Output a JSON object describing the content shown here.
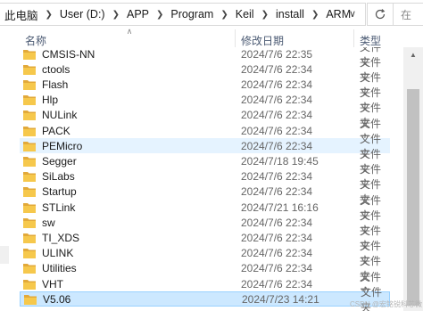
{
  "address": {
    "crumbs": [
      "此电脑",
      "User (D:)",
      "APP",
      "Program",
      "Keil",
      "install",
      "ARM"
    ],
    "search_placeholder": "在"
  },
  "columns": {
    "name": "名称",
    "date": "修改日期",
    "type": "类型"
  },
  "rows": [
    {
      "name": "CMSIS-NN",
      "date": "2024/7/6 22:35",
      "type": "文件夹"
    },
    {
      "name": "ctools",
      "date": "2024/7/6 22:34",
      "type": "文件夹"
    },
    {
      "name": "Flash",
      "date": "2024/7/6 22:34",
      "type": "文件夹"
    },
    {
      "name": "Hlp",
      "date": "2024/7/6 22:34",
      "type": "文件夹"
    },
    {
      "name": "NULink",
      "date": "2024/7/6 22:34",
      "type": "文件夹"
    },
    {
      "name": "PACK",
      "date": "2024/7/6 22:34",
      "type": "文件夹"
    },
    {
      "name": "PEMicro",
      "date": "2024/7/6 22:34",
      "type": "文件夹"
    },
    {
      "name": "Segger",
      "date": "2024/7/18 19:45",
      "type": "文件夹"
    },
    {
      "name": "SiLabs",
      "date": "2024/7/6 22:34",
      "type": "文件夹"
    },
    {
      "name": "Startup",
      "date": "2024/7/6 22:34",
      "type": "文件夹"
    },
    {
      "name": "STLink",
      "date": "2024/7/21 16:16",
      "type": "文件夹"
    },
    {
      "name": "sw",
      "date": "2024/7/6 22:34",
      "type": "文件夹"
    },
    {
      "name": "TI_XDS",
      "date": "2024/7/6 22:34",
      "type": "文件夹"
    },
    {
      "name": "ULINK",
      "date": "2024/7/6 22:34",
      "type": "文件夹"
    },
    {
      "name": "Utilities",
      "date": "2024/7/6 22:34",
      "type": "文件夹"
    },
    {
      "name": "VHT",
      "date": "2024/7/6 22:34",
      "type": "文件夹"
    },
    {
      "name": "V5.06",
      "date": "2024/7/23 14:21",
      "type": "文件夹"
    }
  ],
  "watermark": "CSDN @宏铭锐科芯微",
  "colors": {
    "folder": "#f6c84c",
    "folder_dark": "#e2a93a",
    "selection": "#cce8ff",
    "hover": "#e5f3ff"
  }
}
